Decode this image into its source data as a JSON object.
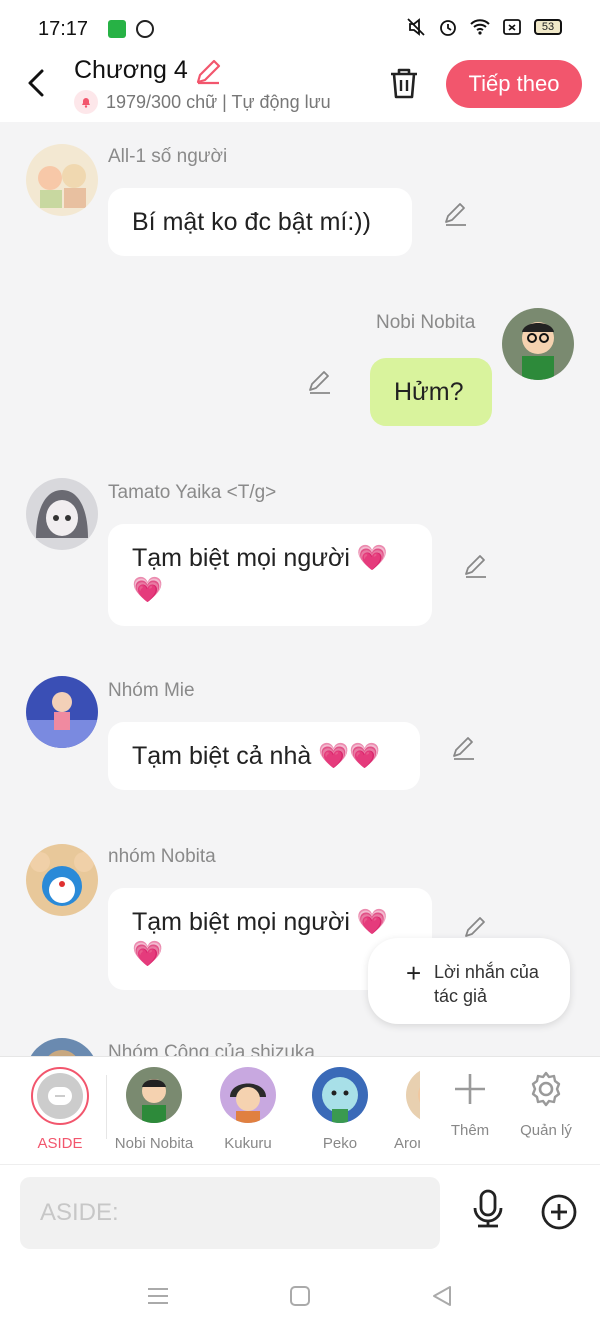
{
  "status_bar": {
    "time": "17:17",
    "battery": "53"
  },
  "header": {
    "title": "Chương 4",
    "meta": "1979/300 chữ | Tự động lưu",
    "next_label": "Tiếp theo"
  },
  "messages": [
    {
      "name": "All-1 số người",
      "text": "Bí mật ko đc bật mí:))"
    },
    {
      "name": "Nobi Nobita",
      "text": "Hửm?"
    },
    {
      "name": "Tamato Yaika <T/g>",
      "text": "Tạm biệt mọi người 💗💗"
    },
    {
      "name": "Nhóm Mie",
      "text": "Tạm biệt cả nhà 💗💗"
    },
    {
      "name": "nhóm Nobita",
      "text": "Tạm biệt mọi người 💗💗"
    },
    {
      "name": "Nhóm Công của shizuka",
      "text": ""
    }
  ],
  "author_note": {
    "label": "Lời nhắn của tác giả"
  },
  "characters": [
    {
      "label": "ASIDE"
    },
    {
      "label": "Nobi Nobita"
    },
    {
      "label": "Kukuru"
    },
    {
      "label": "Peko"
    },
    {
      "label": "Aron"
    }
  ],
  "tools": {
    "more_label": "Thêm",
    "manage_label": "Quản lý"
  },
  "input": {
    "placeholder": "ASIDE:"
  },
  "colors": {
    "accent": "#f2566d",
    "self_bubble": "#d9f39d",
    "background": "#f4f4f5"
  }
}
